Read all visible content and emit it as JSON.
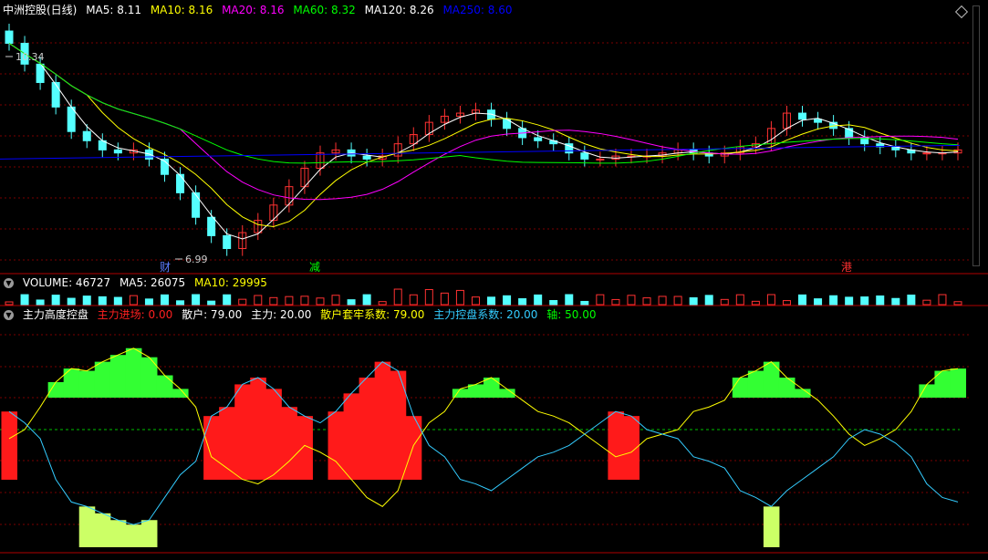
{
  "price_panel": {
    "title": "中洲控股(日线)",
    "ma_labels": [
      {
        "text": "MA5: 8.11",
        "color": "#ffffff"
      },
      {
        "text": "MA10: 8.16",
        "color": "#ffff00"
      },
      {
        "text": "MA20: 8.16",
        "color": "#ff00ff"
      },
      {
        "text": "MA60: 8.32",
        "color": "#00ff00"
      },
      {
        "text": "MA120: 8.26",
        "color": "#ffffff"
      },
      {
        "text": "MA250: 8.60",
        "color": "#0000ff"
      }
    ],
    "high_label": "10.34",
    "low_label": "6.99",
    "event_markers": [
      {
        "text": "财",
        "color": "#5b7cff"
      },
      {
        "text": "减",
        "color": "#00ff00"
      },
      {
        "text": "港",
        "color": "#ff3030"
      }
    ]
  },
  "volume_panel": {
    "labels": [
      {
        "text": "VOLUME: 46727",
        "color": "#ffffff"
      },
      {
        "text": "MA5: 26075",
        "color": "#ffffff"
      },
      {
        "text": "MA10: 29995",
        "color": "#ffff00"
      }
    ]
  },
  "indicator_panel": {
    "title": "主力高度控盘",
    "labels": [
      {
        "text": "主力进场: 0.00",
        "color": "#ff2020"
      },
      {
        "text": "散户: 79.00",
        "color": "#ffffff"
      },
      {
        "text": "主力: 20.00",
        "color": "#ffffff"
      },
      {
        "text": "散户套牢系数: 79.00",
        "color": "#ffff00"
      },
      {
        "text": "主力控盘系数: 20.00",
        "color": "#33ccff"
      },
      {
        "text": "轴: 50.00",
        "color": "#00ff00"
      }
    ]
  },
  "chart_data": {
    "type": "line",
    "title": "中洲控股(日线)",
    "price_range": [
      6.99,
      10.34
    ],
    "close": [
      10.34,
      10.0,
      9.7,
      9.3,
      8.9,
      8.75,
      8.6,
      8.55,
      8.6,
      8.45,
      8.2,
      7.9,
      7.5,
      7.2,
      6.99,
      7.25,
      7.45,
      7.7,
      8.0,
      8.3,
      8.55,
      8.6,
      8.5,
      8.45,
      8.5,
      8.7,
      8.85,
      9.05,
      9.15,
      9.2,
      9.25,
      9.1,
      8.95,
      8.8,
      8.75,
      8.7,
      8.55,
      8.45,
      8.45,
      8.5,
      8.5,
      8.5,
      8.55,
      8.6,
      8.55,
      8.5,
      8.55,
      8.65,
      8.7,
      8.95,
      9.2,
      9.1,
      9.05,
      8.95,
      8.8,
      8.7,
      8.65,
      8.6,
      8.55,
      8.55,
      8.55,
      8.6
    ],
    "volume_ma": {
      "VOLUME": 46727,
      "MA5": 26075,
      "MA10": 29995
    },
    "indicator": {
      "retail": [
        48,
        52,
        62,
        73,
        79,
        78,
        82,
        85,
        88,
        84,
        76,
        70,
        62,
        40,
        35,
        30,
        28,
        32,
        38,
        45,
        42,
        38,
        30,
        22,
        18,
        25,
        45,
        55,
        60,
        70,
        72,
        75,
        70,
        65,
        60,
        58,
        55,
        50,
        45,
        40,
        42,
        48,
        50,
        52,
        60,
        62,
        65,
        75,
        78,
        82,
        75,
        70,
        65,
        58,
        50,
        45,
        48,
        52,
        60,
        72,
        78,
        79
      ],
      "main_control": [
        60,
        55,
        48,
        30,
        20,
        18,
        15,
        12,
        10,
        12,
        22,
        32,
        38,
        58,
        62,
        72,
        75,
        70,
        62,
        58,
        55,
        60,
        68,
        75,
        82,
        78,
        58,
        45,
        40,
        30,
        28,
        25,
        30,
        35,
        40,
        42,
        45,
        50,
        55,
        60,
        58,
        52,
        50,
        48,
        40,
        38,
        35,
        25,
        22,
        18,
        25,
        30,
        35,
        40,
        48,
        52,
        50,
        46,
        40,
        28,
        22,
        20
      ],
      "axis": 50
    }
  }
}
